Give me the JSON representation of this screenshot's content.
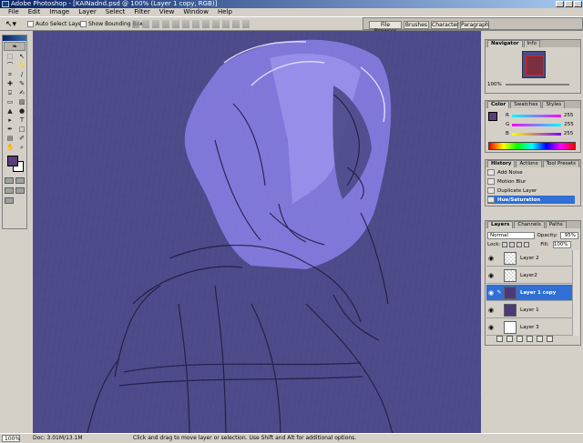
{
  "window": {
    "title": "Adobe Photoshop - [KAINadnd.psd @ 100% (Layer 1 copy, RGB)]"
  },
  "menu": [
    "File",
    "Edit",
    "Image",
    "Layer",
    "Select",
    "Filter",
    "View",
    "Window",
    "Help"
  ],
  "options": {
    "auto_select_label": "Auto Select Layer",
    "bounding_box_label": "Show Bounding Box"
  },
  "palette_well": {
    "tabs": [
      "File Browser",
      "Brushes",
      "Character",
      "Paragraph"
    ]
  },
  "navigator": {
    "tabs": [
      "Navigator",
      "Info"
    ],
    "zoom": "100%"
  },
  "color": {
    "tabs": [
      "Color",
      "Swatches",
      "Styles"
    ],
    "channels": [
      {
        "label": "R",
        "value": "255",
        "color": "#ff00ff"
      },
      {
        "label": "G",
        "value": "255",
        "color": "#00ffff"
      },
      {
        "label": "B",
        "value": "255",
        "color": "#8000ff"
      }
    ],
    "foreground": "#5a3e7a"
  },
  "history": {
    "tabs": [
      "History",
      "Actions",
      "Tool Presets"
    ],
    "items": [
      "Add Noise",
      "Motion Blur",
      "Duplicate Layer",
      "Hue/Saturation"
    ],
    "selected_index": 3
  },
  "layers": {
    "tabs": [
      "Layers",
      "Channels",
      "Paths"
    ],
    "blend_mode": "Normal",
    "opacity_label": "Opacity:",
    "opacity": "95%",
    "lock_label": "Lock:",
    "fill_label": "Fill:",
    "fill": "100%",
    "items": [
      {
        "name": "Layer 2",
        "thumb": "checker"
      },
      {
        "name": "Layer2",
        "thumb": "checker"
      },
      {
        "name": "Layer 1 copy",
        "thumb": "purple"
      },
      {
        "name": "Layer 1",
        "thumb": "purple"
      },
      {
        "name": "Layer 3",
        "thumb": "white"
      }
    ],
    "selected_index": 2
  },
  "status": {
    "zoom": "100%",
    "doc": "Doc: 3.01M/13.1M",
    "hint": "Click and drag to move layer or selection. Use Shift and Alt for additional options."
  },
  "canvas": {
    "background": "#4c4a88",
    "hood_color": "#8a80e8"
  }
}
